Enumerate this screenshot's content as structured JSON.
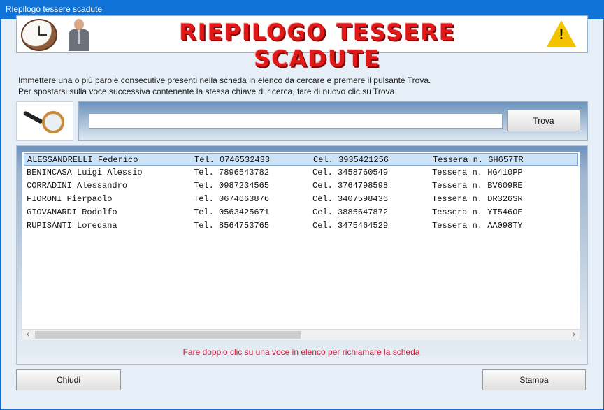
{
  "window": {
    "title": "Riepilogo tessere scadute"
  },
  "banner": {
    "title": "RIEPILOGO TESSERE SCADUTE"
  },
  "instructions": [
    "Immettere una o più parole consecutive presenti nella scheda in elenco da cercare e premere il pulsante Trova.",
    "Per spostarsi sulla voce successiva contenente la stessa chiave di ricerca, fare di nuovo clic su Trova."
  ],
  "search": {
    "value": "",
    "button_label": "Trova"
  },
  "list": {
    "selected_index": 0,
    "rows": [
      {
        "name": "ALESSANDRELLI Federico",
        "tel": "Tel. 0746532433",
        "cel": "Cel. 3935421256",
        "tessera": "Tessera n. GH657TR"
      },
      {
        "name": "BENINCASA Luigi Alessio",
        "tel": "Tel. 7896543782",
        "cel": "Cel. 3458760549",
        "tessera": "Tessera n. HG410PP"
      },
      {
        "name": "CORRADINI Alessandro",
        "tel": "Tel. 0987234565",
        "cel": "Cel. 3764798598",
        "tessera": "Tessera n. BV609RE"
      },
      {
        "name": "FIORONI Pierpaolo",
        "tel": "Tel. 0674663876",
        "cel": "Cel. 3407598436",
        "tessera": "Tessera n. DR326SR"
      },
      {
        "name": "GIOVANARDI Rodolfo",
        "tel": "Tel. 0563425671",
        "cel": "Cel. 3885647872",
        "tessera": "Tessera n. YT546OE"
      },
      {
        "name": "RUPISANTI Loredana",
        "tel": "Tel. 8564753765",
        "cel": "Cel. 3475464529",
        "tessera": "Tessera n. AA098TY"
      }
    ]
  },
  "hint": "Fare doppio clic su una voce in elenco per richiamare la scheda",
  "buttons": {
    "close": "Chiudi",
    "print": "Stampa"
  },
  "colors": {
    "titlebar": "#0f73d8",
    "banner_text": "#e01818",
    "hint_text": "#c81e3a",
    "selection": "#cde3f7"
  }
}
